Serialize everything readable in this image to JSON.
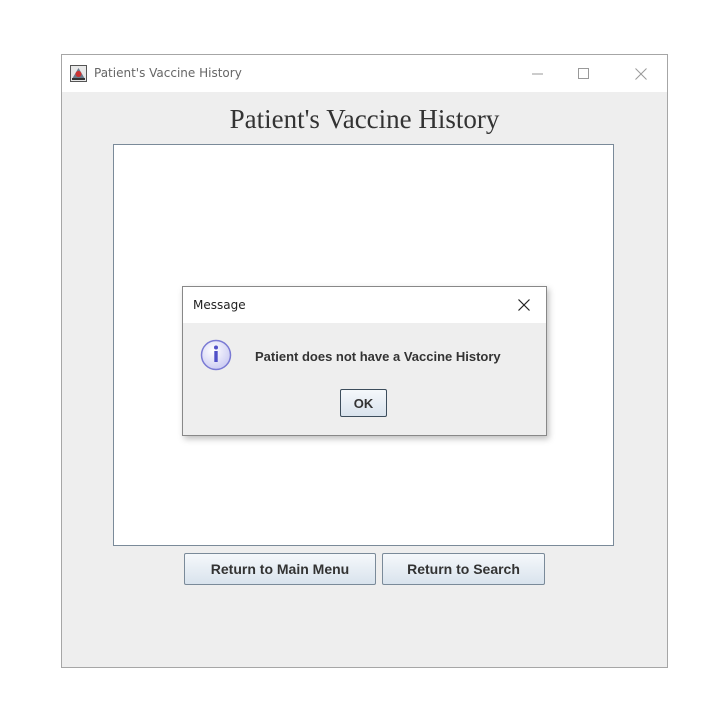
{
  "window": {
    "title": "Patient's Vaccine History",
    "icon": "java-app-icon",
    "controls": [
      "minimize-icon",
      "maximize-icon",
      "close-icon"
    ]
  },
  "main": {
    "heading": "Patient's Vaccine History",
    "buttons": {
      "main_menu": "Return to Main Menu",
      "search": "Return to Search"
    }
  },
  "dialog": {
    "title": "Message",
    "icon": "info-icon",
    "message": "Patient does not have a Vaccine History",
    "ok_label": "OK"
  },
  "colors": {
    "window_bg": "#eeeeee",
    "button_border": "#7a8a99",
    "info_icon": "#8a8ae0"
  }
}
